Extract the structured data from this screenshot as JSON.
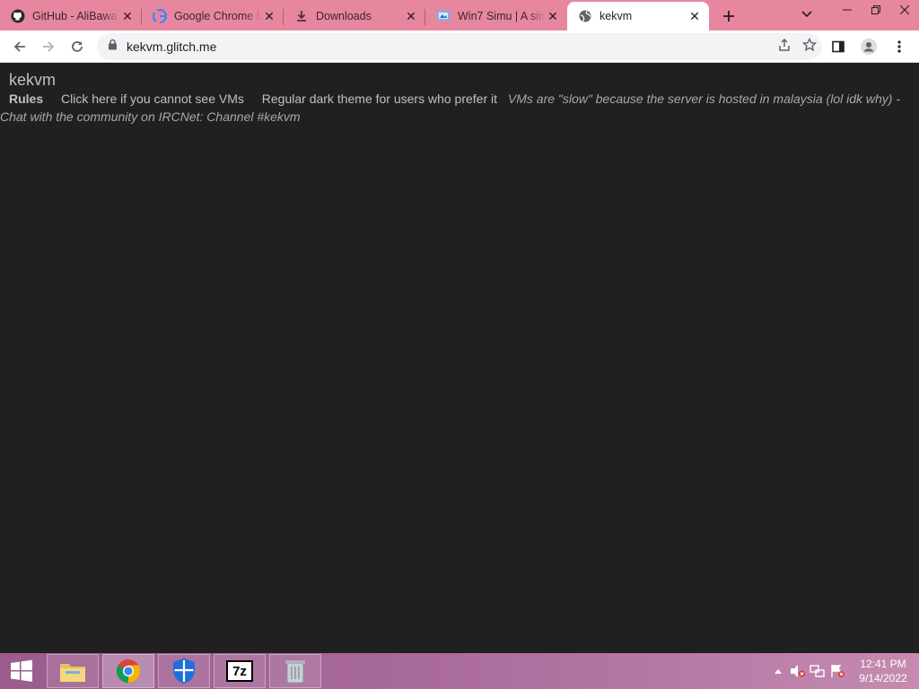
{
  "browser": {
    "tabs": [
      {
        "title": "GitHub - AliBawa",
        "icon": "github-icon",
        "active": false
      },
      {
        "title": "Google Chrome b",
        "icon": "google-icon",
        "active": false
      },
      {
        "title": "Downloads",
        "icon": "download-icon",
        "active": false
      },
      {
        "title": "Win7 Simu | A sin",
        "icon": "win7simu-icon",
        "active": false
      },
      {
        "title": "kekvm",
        "icon": "globe-icon",
        "active": true
      }
    ],
    "url": "kekvm.glitch.me",
    "accent": "#e7879f"
  },
  "page": {
    "site_title": "kekvm",
    "nav": {
      "rules": "Rules",
      "cannot_see": "Click here if you cannot see VMs",
      "dark_theme": "Regular dark theme for users who prefer it",
      "note": "VMs are \"slow\" because the server is hosted in malaysia (lol idk why) - Chat with the community on IRCNet: Channel #kekvm"
    }
  },
  "taskbar": {
    "apps": [
      "file-explorer-icon",
      "chrome-icon",
      "defender-icon",
      "7zip-icon",
      "recycle-app-icon"
    ],
    "sevenzip_label": "7z",
    "clock": {
      "time": "12:41 PM",
      "date": "9/14/2022"
    }
  }
}
